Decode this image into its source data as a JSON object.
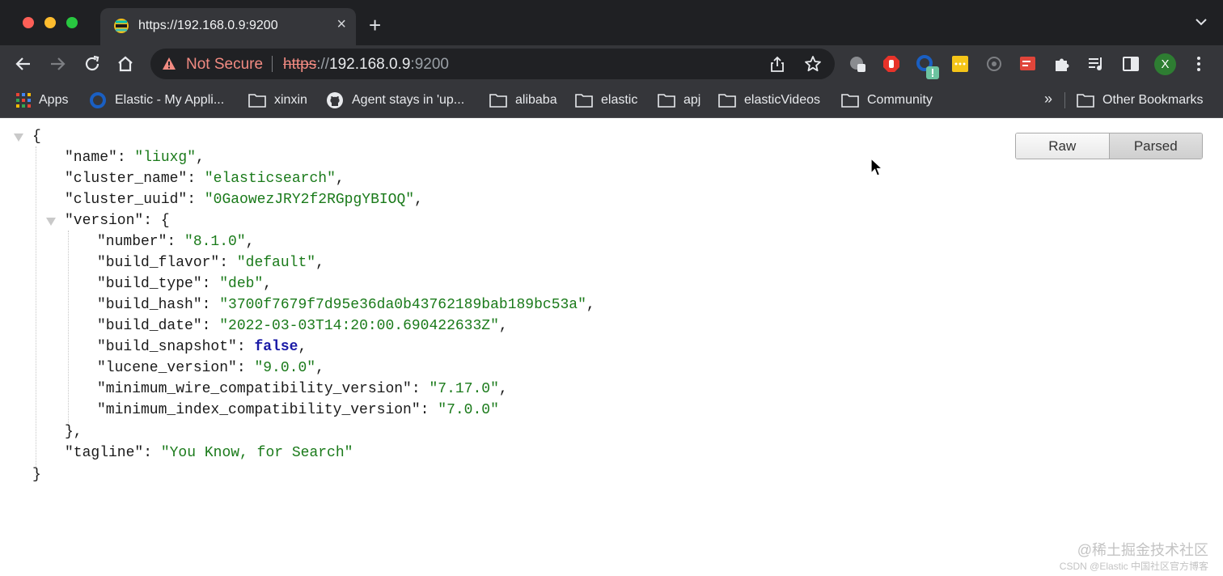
{
  "tab": {
    "title": "https://192.168.0.9:9200"
  },
  "omnibox": {
    "security_label": "Not Secure",
    "url_scheme": "https",
    "url_separator": "://",
    "url_host": "192.168.0.9",
    "url_port": ":9200"
  },
  "profile": {
    "initial": "X"
  },
  "bookmarks": {
    "apps": "Apps",
    "items": [
      "Elastic - My Appli...",
      "xinxin",
      "Agent stays in 'up...",
      "alibaba",
      "elastic",
      "apj",
      "elasticVideos",
      "Community"
    ],
    "more": "»",
    "other": "Other Bookmarks"
  },
  "viewer": {
    "raw": "Raw",
    "parsed": "Parsed"
  },
  "json": {
    "name": "\"liuxg\"",
    "cluster_name": "\"elasticsearch\"",
    "cluster_uuid": "\"0GaowezJRY2f2RGpgYBIOQ\"",
    "version": {
      "number": "\"8.1.0\"",
      "build_flavor": "\"default\"",
      "build_type": "\"deb\"",
      "build_hash": "\"3700f7679f7d95e36da0b43762189bab189bc53a\"",
      "build_date": "\"2022-03-03T14:20:00.690422633Z\"",
      "build_snapshot": "false",
      "lucene_version": "\"9.0.0\"",
      "minimum_wire_compatibility_version": "\"7.17.0\"",
      "minimum_index_compatibility_version": "\"7.0.0\""
    },
    "tagline": "\"You Know, for Search\""
  },
  "watermark": {
    "line1": "@稀土掘金技术社区",
    "line2": "CSDN @Elastic 中国社区官方博客"
  },
  "colors": {
    "chrome_bg": "#35363a",
    "tab_strip_bg": "#1f2023",
    "string": "#1a7a1a",
    "boolean": "#1a1aa6",
    "not_secure": "#f28b82"
  }
}
